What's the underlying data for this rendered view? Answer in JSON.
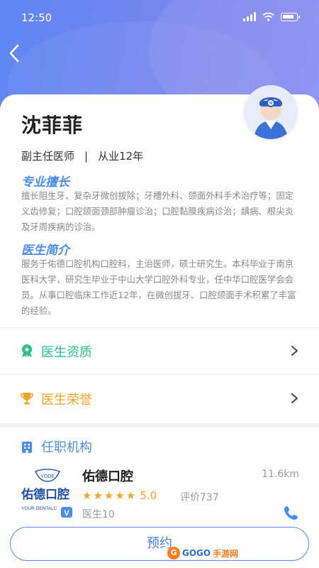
{
  "status_bar": {
    "time": "12:50"
  },
  "doctor": {
    "name": "沈菲菲",
    "title": "副主任医师",
    "separator": "|",
    "experience": "从业12年"
  },
  "specialty": {
    "heading": "专业擅长",
    "text": "擅长阻生牙、复杂牙微创拔除；牙槽外科、颌面外科手术治疗等；固定义齿修复；口腔颌面颈部肿瘤诊治；口腔黏膜疾病诊治；龋病、根尖炎及牙周疾病的诊治。"
  },
  "bio": {
    "heading": "医生简介",
    "text": "服务于佑德口腔机构口腔科，主治医师，硕士研究生。本科毕业于南京医科大学，研究生毕业于中山大学口腔外科专业，任中华口腔医学会会员。从事口腔临床工作近12年，在微创拔牙、口腔颌面手术积累了丰富的经验。"
  },
  "rows": [
    {
      "label": "医生资质",
      "color": "#2bbf8a",
      "icon": "badge-icon"
    },
    {
      "label": "医生荣誉",
      "color": "#f5a524",
      "icon": "trophy-icon"
    }
  ],
  "institution": {
    "heading": "任职机构",
    "name": "佑德口腔",
    "distance": "11.6km",
    "stars": 5,
    "score": "5.0",
    "reviews": "评价737",
    "doctors": "医生10",
    "logo_main": "佑德口腔",
    "logo_sub": "YOUR DENTALC",
    "logo_top": "YODE",
    "logo_badge": "V"
  },
  "book_button": "预约",
  "watermark": {
    "badge": "G",
    "text1": "GOGO",
    "text2": "手游网"
  },
  "colors": {
    "accent": "#4a8df0",
    "star": "#f5a524",
    "green": "#2bbf8a"
  }
}
